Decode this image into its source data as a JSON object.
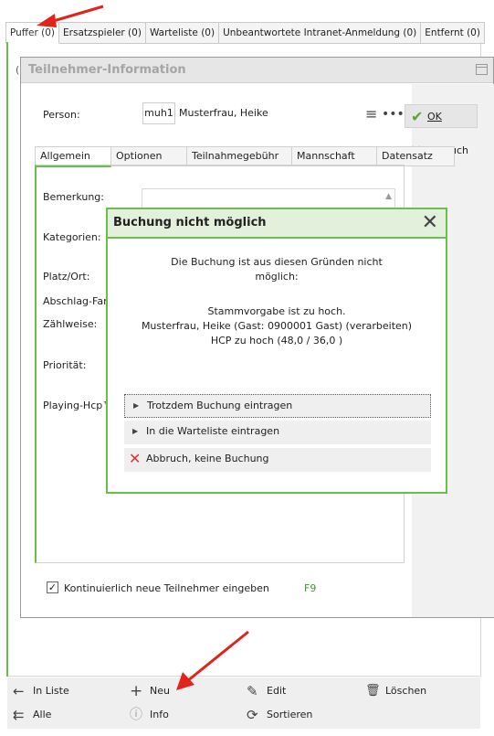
{
  "top_tabs": [
    "Puffer (0)",
    "Ersatzspieler (0)",
    "Warteliste (0)",
    "Unbeantwortete Intranet-Anmeldung (0)",
    "Entfernt (0)"
  ],
  "dialog": {
    "title": "Teilnehmer-Information",
    "person_label": "Person:",
    "person_id": "muh1",
    "person_name": "Musterfrau, Heike",
    "ok_label": "OK",
    "cancel_label": "Abbruch",
    "tabs": [
      "Allgemein",
      "Optionen",
      "Teilnahmegebühr",
      "Mannschaft",
      "Datensatz"
    ],
    "fields": {
      "bemerkung": "Bemerkung:",
      "kategorien": "Kategorien:",
      "platz": "Platz/Ort:",
      "abschlag": "Abschlag-Farb",
      "zaehlweise": "Zählweise:",
      "prioritaet": "Priorität:",
      "playing_hcp": "Playing-Hcp™"
    },
    "continuous_label": "Kontinuierlich neue Teilnehmer eingeben",
    "continuous_shortcut": "F9"
  },
  "modal": {
    "title": "Buchung nicht möglich",
    "msg_line1": "Die Buchung ist aus diesen Gründen nicht",
    "msg_line2": "möglich:",
    "reason_line1": "Stammvorgabe ist zu hoch.",
    "reason_line2": "Musterfrau, Heike (Gast: 0900001 Gast) (verarbeiten)",
    "reason_line3": "HCP zu hoch (48,0  / 36,0 )",
    "action1": "Trotzdem Buchung eintragen",
    "action2": "In die Warteliste eintragen",
    "action3": "Abbruch, keine Buchung"
  },
  "toolbar": {
    "in_liste": "In Liste",
    "neu": "Neu",
    "edit": "Edit",
    "loeschen": "Löschen",
    "alle": "Alle",
    "info": "Info",
    "sortieren": "Sortieren"
  },
  "colors": {
    "accent_green": "#6abf4b",
    "cancel_red": "#d6332e",
    "ok_green": "#5aa43a",
    "annotation_red": "#e0241c"
  }
}
